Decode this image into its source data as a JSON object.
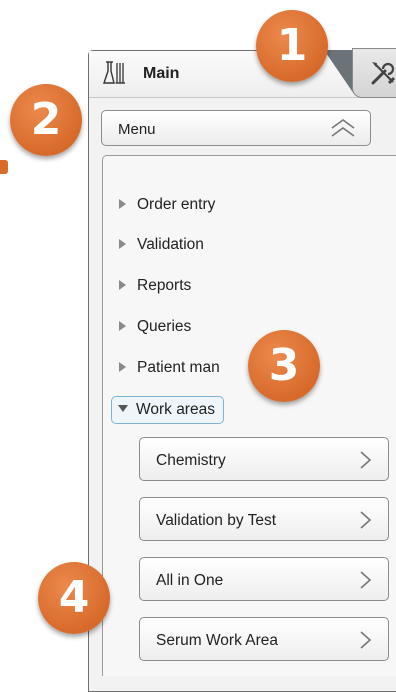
{
  "panel": {
    "title": "Main",
    "flask_icon": "flask-icon",
    "tools_icon": "tools-icon"
  },
  "menu": {
    "label": "Menu",
    "collapse_icon": "double-chevron-up-icon"
  },
  "tree": {
    "items": [
      {
        "label": "Order entry"
      },
      {
        "label": "Validation"
      },
      {
        "label": "Reports"
      },
      {
        "label": "Queries"
      },
      {
        "label": "Patient man"
      }
    ],
    "open_item": {
      "label": "Work areas"
    },
    "work_areas": [
      {
        "label": "Chemistry"
      },
      {
        "label": "Validation by Test"
      },
      {
        "label": "All in One"
      },
      {
        "label": "Serum Work Area"
      }
    ]
  },
  "callouts": [
    "1",
    "2",
    "3",
    "4"
  ],
  "colors": {
    "callout": "#d76a2b",
    "panel_border": "#6f6f6f",
    "selection_border": "#7fb2d4"
  }
}
